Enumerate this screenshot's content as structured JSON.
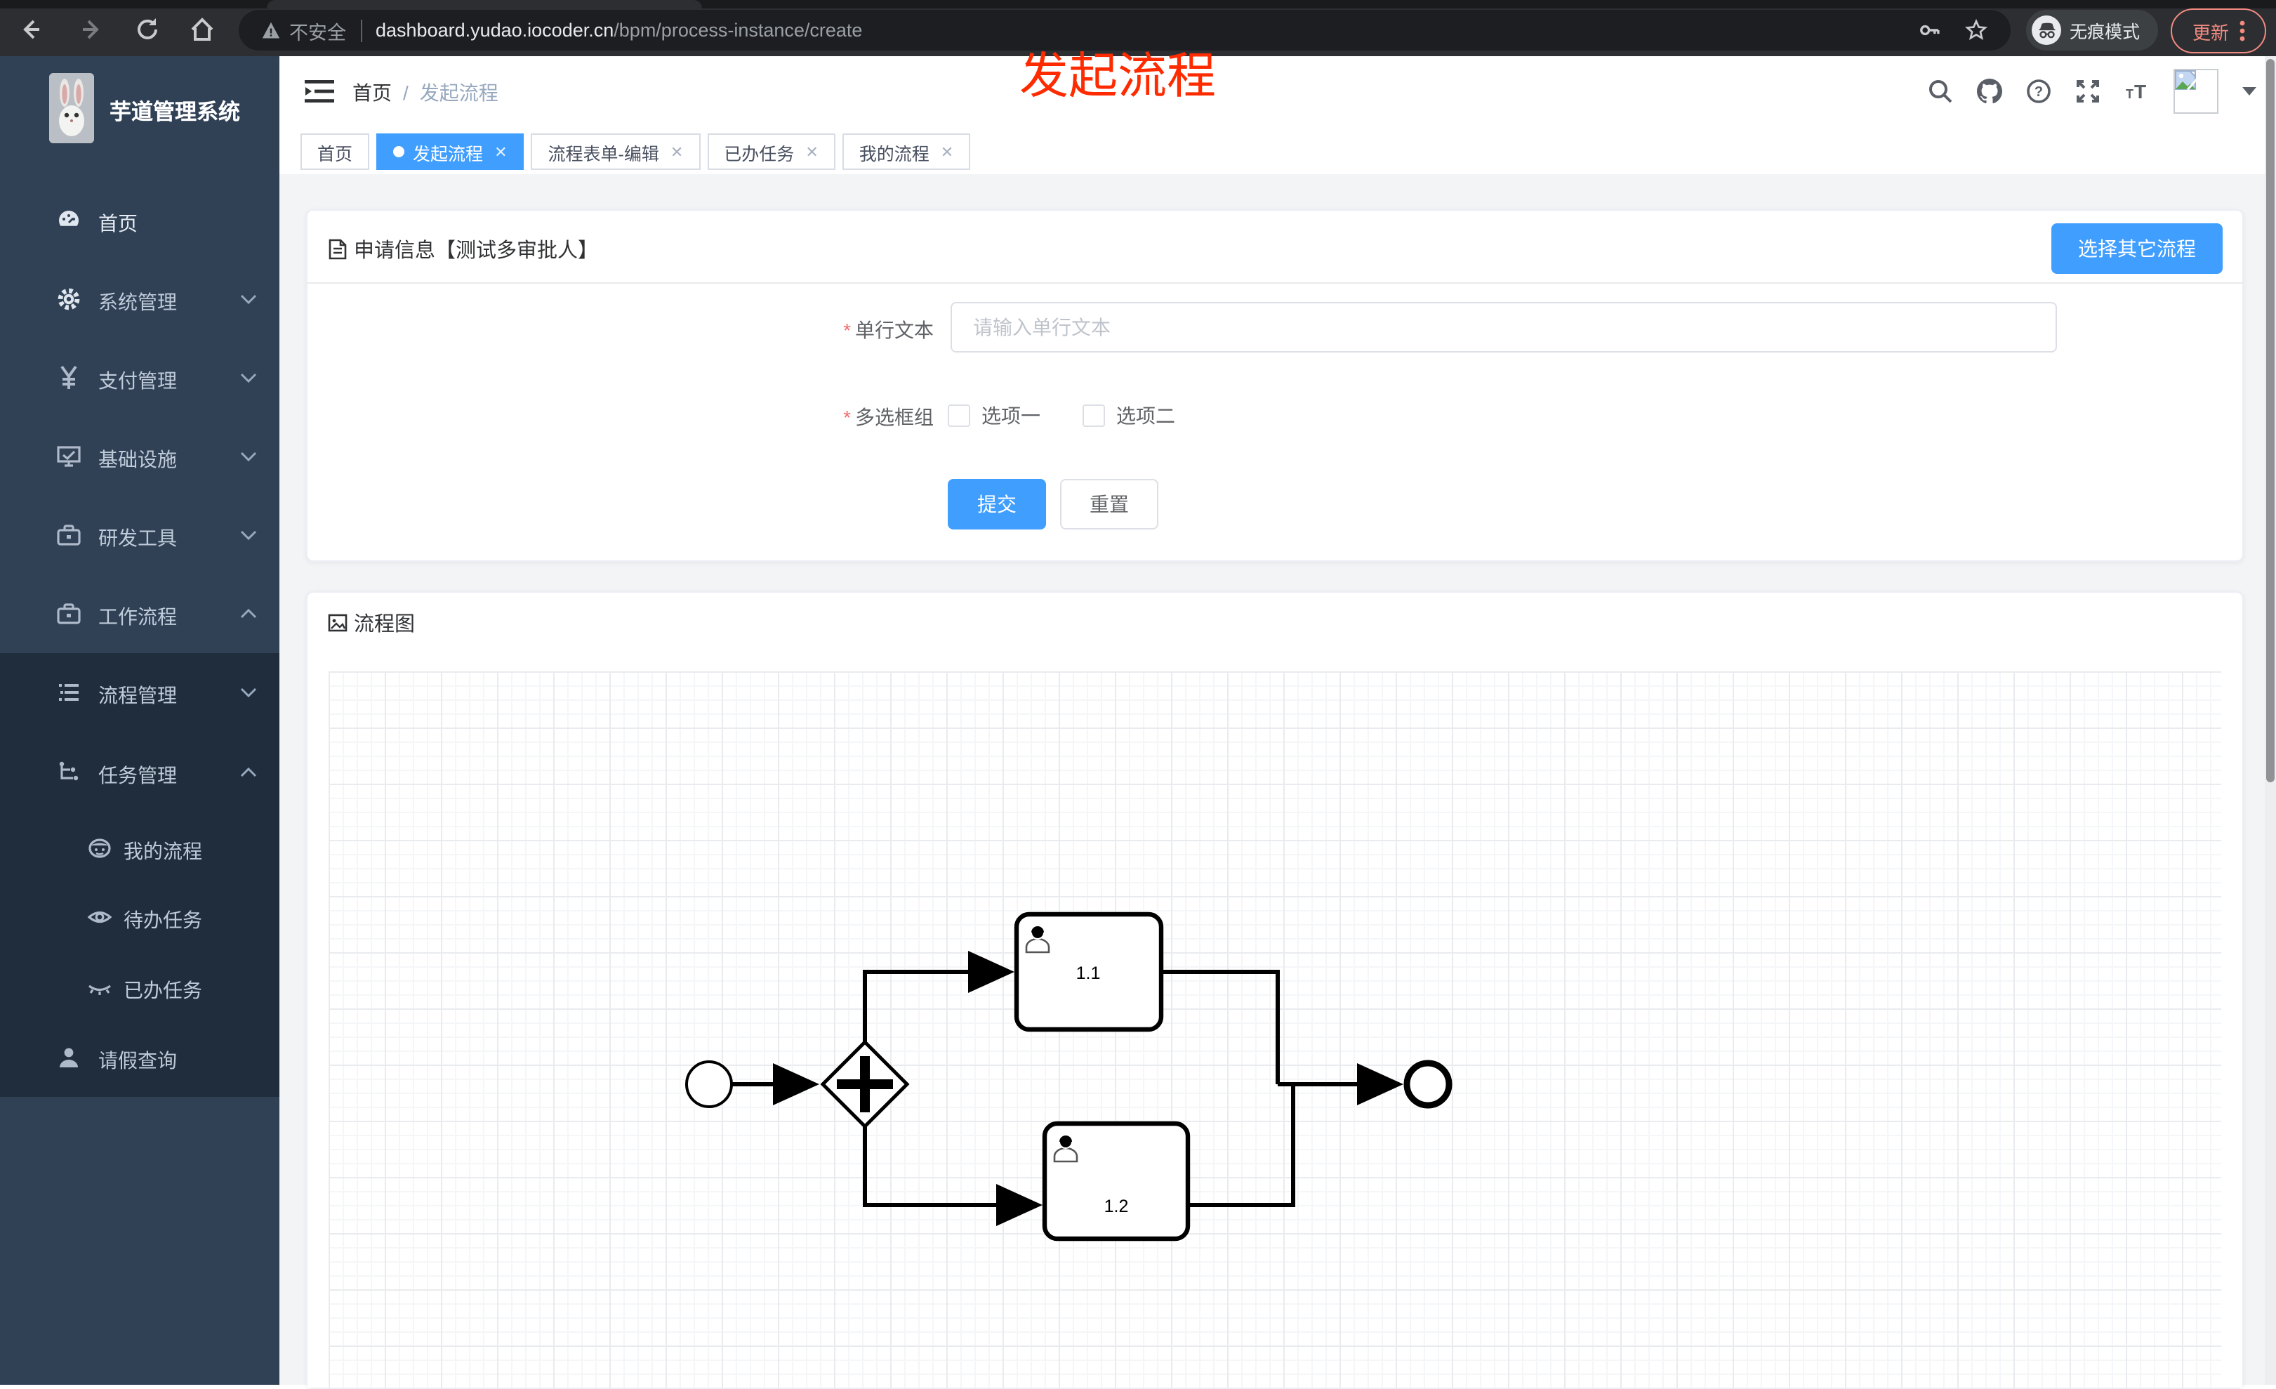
{
  "browser": {
    "security_label": "不安全",
    "url_host": "dashboard.yudao.iocoder.cn",
    "url_path": "/bpm/process-instance/create",
    "incognito_label": "无痕模式",
    "update_label": "更新"
  },
  "annotation": {
    "text": "发起流程",
    "color": "#ff2b00"
  },
  "sidebar": {
    "app_title": "芋道管理系统",
    "items": [
      {
        "label": "首页",
        "icon": "dashboard-icon"
      },
      {
        "label": "系统管理",
        "icon": "gear-icon",
        "chevron": "down"
      },
      {
        "label": "支付管理",
        "icon": "yen-icon",
        "chevron": "down"
      },
      {
        "label": "基础设施",
        "icon": "monitor-icon",
        "chevron": "down"
      },
      {
        "label": "研发工具",
        "icon": "toolbox-icon",
        "chevron": "down"
      },
      {
        "label": "工作流程",
        "icon": "briefcase-icon",
        "chevron": "up"
      }
    ],
    "submenu": [
      {
        "label": "流程管理",
        "icon": "list-icon",
        "chevron": "down"
      },
      {
        "label": "任务管理",
        "icon": "tree-icon",
        "chevron": "up"
      },
      {
        "label": "我的流程",
        "icon": "robot-icon"
      },
      {
        "label": "待办任务",
        "icon": "eye-icon"
      },
      {
        "label": "已办任务",
        "icon": "eye-closed-icon"
      },
      {
        "label": "请假查询",
        "icon": "user-icon"
      }
    ]
  },
  "header": {
    "breadcrumb_home": "首页",
    "breadcrumb_current": "发起流程"
  },
  "tabs": [
    {
      "label": "首页",
      "active": false,
      "closable": false
    },
    {
      "label": "发起流程",
      "active": true,
      "closable": true
    },
    {
      "label": "流程表单-编辑",
      "active": false,
      "closable": true
    },
    {
      "label": "已办任务",
      "active": false,
      "closable": true
    },
    {
      "label": "我的流程",
      "active": false,
      "closable": true
    }
  ],
  "form_card": {
    "title": "申请信息【测试多审批人】",
    "action_button": "选择其它流程",
    "fields": {
      "text": {
        "label": "单行文本",
        "required": true,
        "placeholder": "请输入单行文本",
        "value": ""
      },
      "checkbox_group": {
        "label": "多选框组",
        "required": true,
        "options": [
          {
            "label": "选项一",
            "checked": false
          },
          {
            "label": "选项二",
            "checked": false
          }
        ]
      }
    },
    "submit_label": "提交",
    "reset_label": "重置"
  },
  "diagram_card": {
    "title": "流程图",
    "nodes": [
      {
        "id": "start",
        "type": "start-event"
      },
      {
        "id": "gateway",
        "type": "parallel-gateway"
      },
      {
        "id": "task1",
        "type": "user-task",
        "label": "1.1"
      },
      {
        "id": "task2",
        "type": "user-task",
        "label": "1.2"
      },
      {
        "id": "end",
        "type": "end-event"
      }
    ],
    "edges": [
      [
        "start",
        "gateway"
      ],
      [
        "gateway",
        "task1"
      ],
      [
        "gateway",
        "task2"
      ],
      [
        "task1",
        "end"
      ],
      [
        "task2",
        "end"
      ]
    ]
  },
  "colors": {
    "primary": "#409eff",
    "sidebar_bg": "#304156",
    "submenu_bg": "#1f2d3d",
    "annotation": "#ff2b00",
    "update_accent": "#f28b82"
  }
}
